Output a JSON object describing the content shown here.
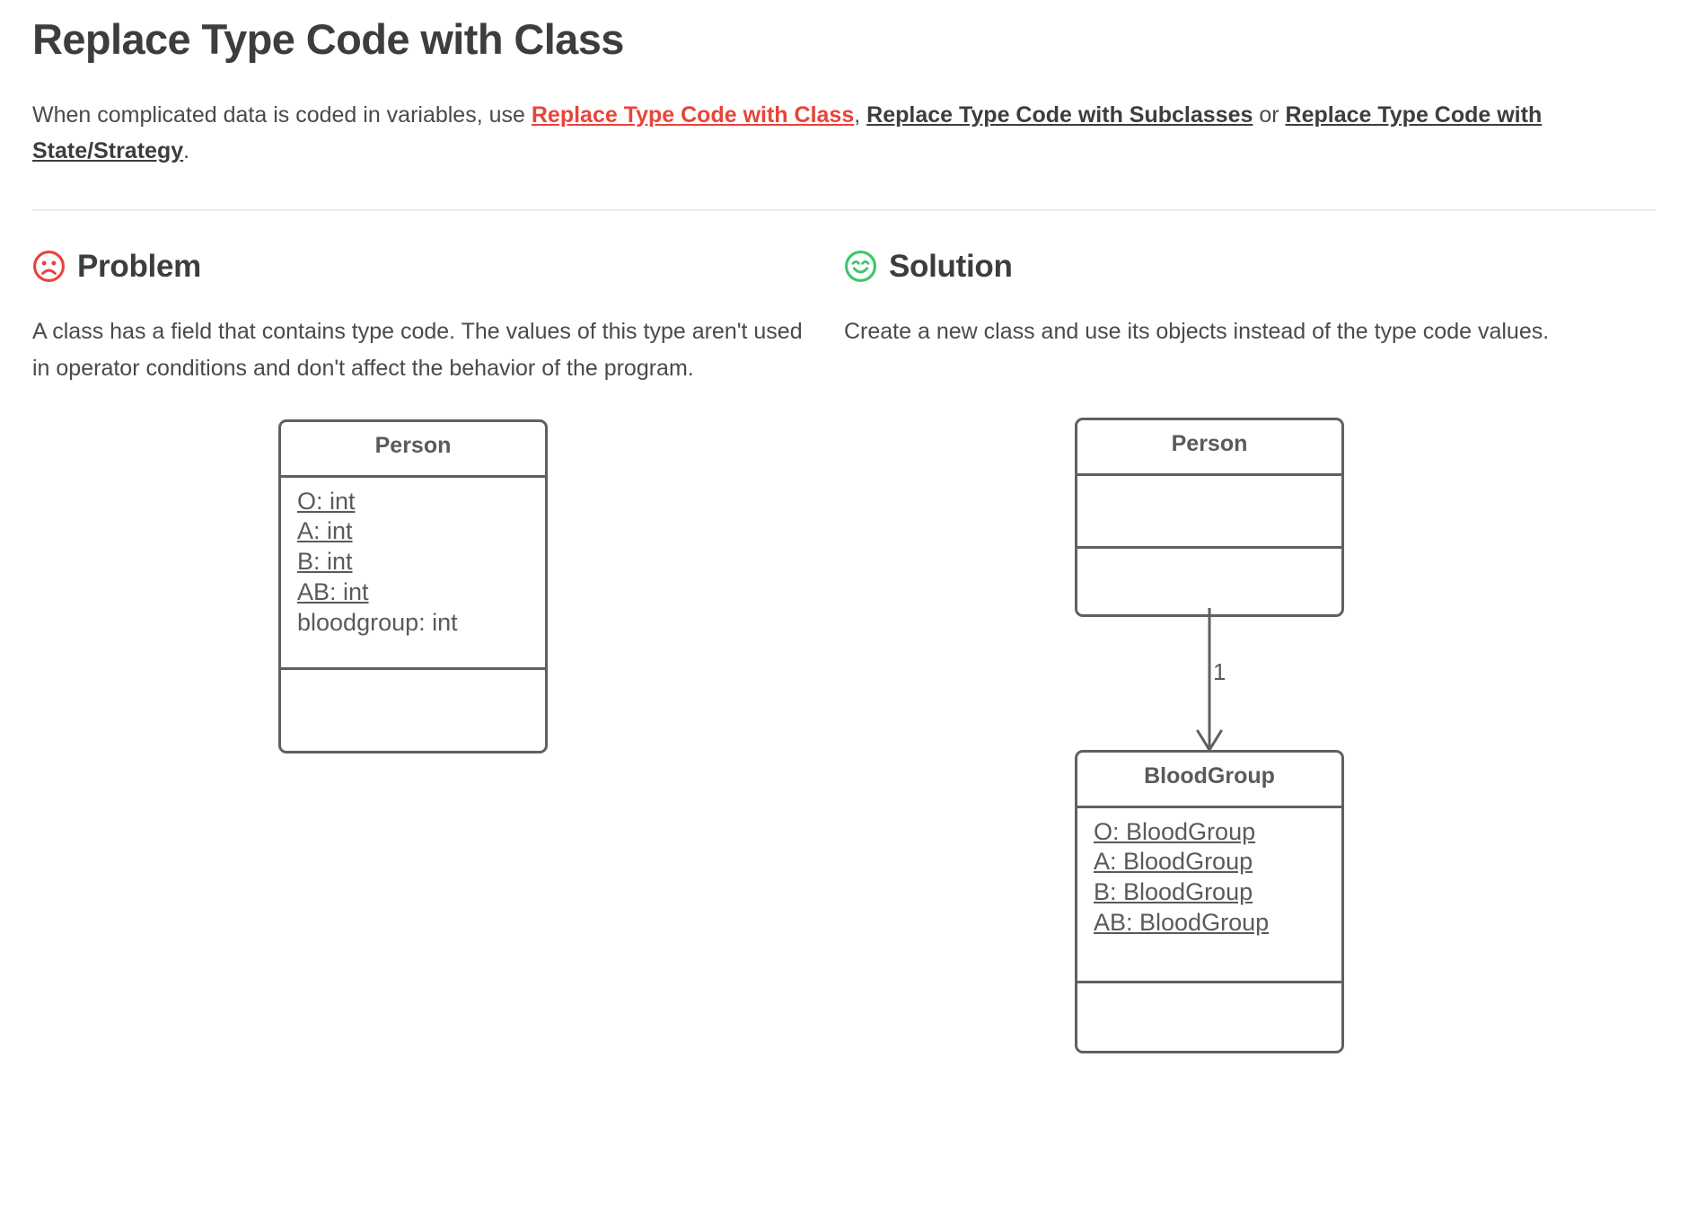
{
  "page": {
    "title": "Replace Type Code with Class",
    "intro": {
      "lead": "When complicated data is coded in variables, use ",
      "ref1": "Replace Type Code with Class",
      "sep1": ", ",
      "ref2": "Replace Type Code with Subclasses",
      "sep2": " or ",
      "ref3": "Replace Type Code with State/Strategy",
      "tail": "."
    },
    "colors": {
      "link_red": "#e8443a",
      "heading_gray": "#3d3d3d",
      "body_gray": "#4a4a4a",
      "uml_stroke": "#606060",
      "problem_icon": "#e8443a",
      "solution_icon": "#3cc86a",
      "divider": "#ececed"
    }
  },
  "sections": [
    {
      "key": "problem",
      "icon": "sad-face-icon",
      "title": "Problem",
      "body": "A class has a field that contains type code. The values of this type aren't used in operator conditions and don't affect the behavior of the program."
    },
    {
      "key": "solution",
      "icon": "happy-face-icon",
      "title": "Solution",
      "body": "Create a new class and use its objects instead of the type code values."
    }
  ],
  "diagrams": {
    "problem": {
      "classes": [
        {
          "name": "Person",
          "attributes": [
            {
              "text": "O: int",
              "static": true
            },
            {
              "text": "A: int",
              "static": true
            },
            {
              "text": "B: int",
              "static": true
            },
            {
              "text": "AB: int",
              "static": true
            },
            {
              "text": "bloodgroup: int",
              "static": false
            }
          ],
          "operations": []
        }
      ]
    },
    "solution": {
      "classes": [
        {
          "name": "Person",
          "attributes": [],
          "operations": []
        },
        {
          "name": "BloodGroup",
          "attributes": [
            {
              "text": "O: BloodGroup",
              "static": true
            },
            {
              "text": "A: BloodGroup",
              "static": true
            },
            {
              "text": "B: BloodGroup",
              "static": true
            },
            {
              "text": "AB: BloodGroup",
              "static": true
            }
          ],
          "operations": []
        }
      ],
      "association": {
        "from": "Person",
        "to": "BloodGroup",
        "multiplicity": "1",
        "arrow": "open"
      }
    }
  }
}
